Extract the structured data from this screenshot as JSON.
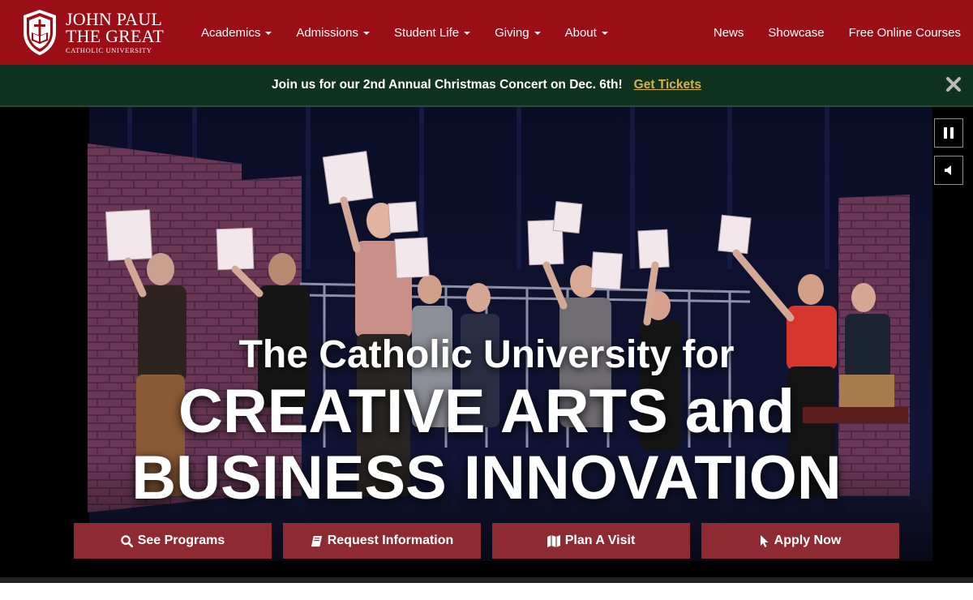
{
  "brand": {
    "line1": "JOHN PAUL",
    "line2": "THE GREAT",
    "line3": "CATHOLIC UNIVERSITY"
  },
  "nav": {
    "left": [
      {
        "label": "Academics"
      },
      {
        "label": "Admissions"
      },
      {
        "label": "Student Life"
      },
      {
        "label": "Giving"
      },
      {
        "label": "About"
      }
    ],
    "right": [
      {
        "label": "News"
      },
      {
        "label": "Showcase"
      },
      {
        "label": "Free Online Courses"
      }
    ]
  },
  "announcement": {
    "message": "Join us for our 2nd Annual Christmas Concert on Dec. 6th!",
    "link": "Get Tickets"
  },
  "hero": {
    "line1": "The Catholic University for",
    "line2": "CREATIVE ARTS and",
    "line3": "BUSINESS INNOVATION"
  },
  "cta": {
    "see_programs": "See Programs",
    "request_info": "Request Information",
    "plan_visit": "Plan A Visit",
    "apply_now": "Apply Now"
  },
  "icons": {
    "close": "close-icon",
    "pause": "pause-icon",
    "mute": "volume-icon",
    "search": "search-icon",
    "book": "book-icon",
    "map": "map-icon",
    "pointer": "pointer-icon"
  },
  "colors": {
    "nav_bg": "#9b0e16",
    "announce_bg": "#10331f",
    "announce_link": "#d7b24b",
    "cta_bg": "#8e2a31"
  }
}
